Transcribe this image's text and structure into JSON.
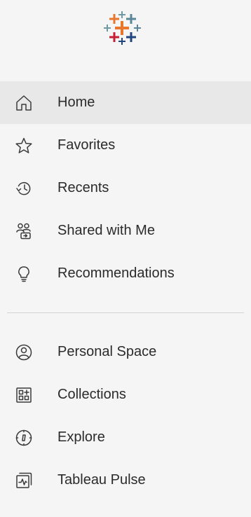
{
  "logo": {
    "icon": "tableau-logo-icon"
  },
  "nav": {
    "primary": [
      {
        "label": "Home",
        "icon": "home-icon",
        "active": true
      },
      {
        "label": "Favorites",
        "icon": "star-icon"
      },
      {
        "label": "Recents",
        "icon": "recents-icon"
      },
      {
        "label": "Shared with Me",
        "icon": "shared-with-me-icon"
      },
      {
        "label": "Recommendations",
        "icon": "lightbulb-icon"
      }
    ],
    "secondary": [
      {
        "label": "Personal Space",
        "icon": "personal-space-icon"
      },
      {
        "label": "Collections",
        "icon": "collections-icon"
      },
      {
        "label": "Explore",
        "icon": "compass-icon"
      },
      {
        "label": "Tableau Pulse",
        "icon": "pulse-icon"
      }
    ]
  },
  "colors": {
    "background": "#f5f5f5",
    "active_bg": "#e8e8e8",
    "text": "#2b2b2b",
    "divider": "#d4d4d4",
    "logo_orange": "#e8762c",
    "logo_blue": "#5b879b",
    "logo_red": "#c72035",
    "logo_navy": "#1f447e",
    "logo_teal": "#59879b",
    "logo_light_blue": "#7099a6"
  }
}
